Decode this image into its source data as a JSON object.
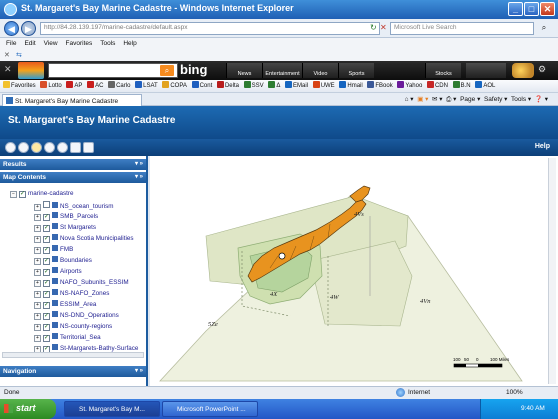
{
  "window": {
    "title": "St. Margaret's Bay Marine Cadastre - Windows Internet Explorer"
  },
  "address": {
    "url": "http://84.28.139.197/marine-cadastre/default.aspx",
    "search_placeholder": "Microsoft Live Search"
  },
  "menu": [
    "File",
    "Edit",
    "View",
    "Favorites",
    "Tools",
    "Help"
  ],
  "bing": {
    "logo": "bing",
    "tabs": [
      "News",
      "Entertainment",
      "Video",
      "Sports"
    ],
    "right_tab": "Stocks"
  },
  "favorites": {
    "label": "Favorites",
    "items": [
      "Lotto",
      "AP",
      "AC",
      "Carlo",
      "LSAT",
      "COPA",
      "Cont",
      "Delta",
      "SSV",
      "Δ",
      "EMail",
      "UWE",
      "Hmail",
      "FBook",
      "Yahoo",
      "CDN",
      "B.N",
      "AOL"
    ]
  },
  "tab": {
    "label": "St. Margaret's Bay Marine Cadastre"
  },
  "command_bar": [
    "Page ▾",
    "Safety ▾",
    "Tools ▾",
    "❓ ▾"
  ],
  "app": {
    "title": "St. Margaret's Bay Marine Cadastre",
    "help": "Help"
  },
  "panels": {
    "results": "Results",
    "map_contents": "Map Contents",
    "navigation": "Navigation",
    "header_buttons": "▾ »"
  },
  "layers": {
    "root": "marine-cadastre",
    "items": [
      {
        "label": "NS_ocean_tourism",
        "checked": false
      },
      {
        "label": "SMB_Parcels",
        "checked": true
      },
      {
        "label": "St Margarets",
        "checked": true
      },
      {
        "label": "Nova Scotia Municipalities",
        "checked": true
      },
      {
        "label": "FMB",
        "checked": true
      },
      {
        "label": "Boundaries",
        "checked": true
      },
      {
        "label": "Airports",
        "checked": true
      },
      {
        "label": "NAFO_Subunits_ESSIM",
        "checked": true
      },
      {
        "label": "NS-NAFO_Zones",
        "checked": true
      },
      {
        "label": "ESSIM_Area",
        "checked": true
      },
      {
        "label": "NS-DND_Operations",
        "checked": true
      },
      {
        "label": "NS-county-regions",
        "checked": true
      },
      {
        "label": "Territorial_Sea",
        "checked": true
      },
      {
        "label": "St-Margarets-Bathy-Surface",
        "checked": true
      }
    ]
  },
  "map": {
    "zones": [
      "4Vs",
      "4X",
      "4W",
      "4Vn",
      "5Ze"
    ],
    "scale": {
      "ticks": [
        "100",
        "50",
        "0",
        "100 Miles"
      ]
    },
    "colors": {
      "land": "#e8931f",
      "zone_fill": "#eef1df",
      "zone_dark": "#cfddb3",
      "esim": "#d9e7c0",
      "bathy": "#9cc89a"
    }
  },
  "status": {
    "left": "Done",
    "zone": "Internet",
    "zoom": "100%"
  },
  "taskbar": {
    "start": "start",
    "items": [
      "St. Margaret's Bay M...",
      "Microsoft PowerPoint ..."
    ],
    "clock": "9:40 AM"
  }
}
